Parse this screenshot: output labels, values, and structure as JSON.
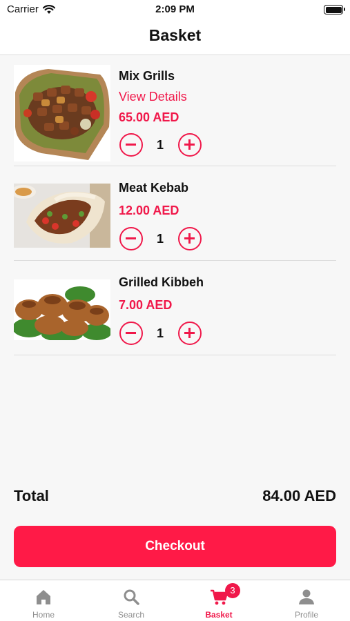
{
  "status_bar": {
    "carrier": "Carrier",
    "time": "2:09 PM"
  },
  "header": {
    "title": "Basket"
  },
  "basket": {
    "items": [
      {
        "name": "Mix Grills",
        "view_details": "View Details",
        "price": "65.00 AED",
        "quantity": "1"
      },
      {
        "name": "Meat Kebab",
        "price": "12.00 AED",
        "quantity": "1"
      },
      {
        "name": "Grilled Kibbeh",
        "price": "7.00 AED",
        "quantity": "1"
      }
    ]
  },
  "summary": {
    "total_label": "Total",
    "total_value": "84.00 AED"
  },
  "checkout": {
    "label": "Checkout"
  },
  "tab_bar": {
    "tabs": [
      {
        "label": "Home",
        "icon": "home-icon"
      },
      {
        "label": "Search",
        "icon": "search-icon"
      },
      {
        "label": "Basket",
        "icon": "cart-icon",
        "badge": "3",
        "active": true
      },
      {
        "label": "Profile",
        "icon": "person-icon"
      }
    ]
  },
  "colors": {
    "accent": "#f0184a",
    "checkout_bg": "#ff1a47",
    "inactive": "#8e8e8e",
    "background": "#f7f7f7"
  }
}
